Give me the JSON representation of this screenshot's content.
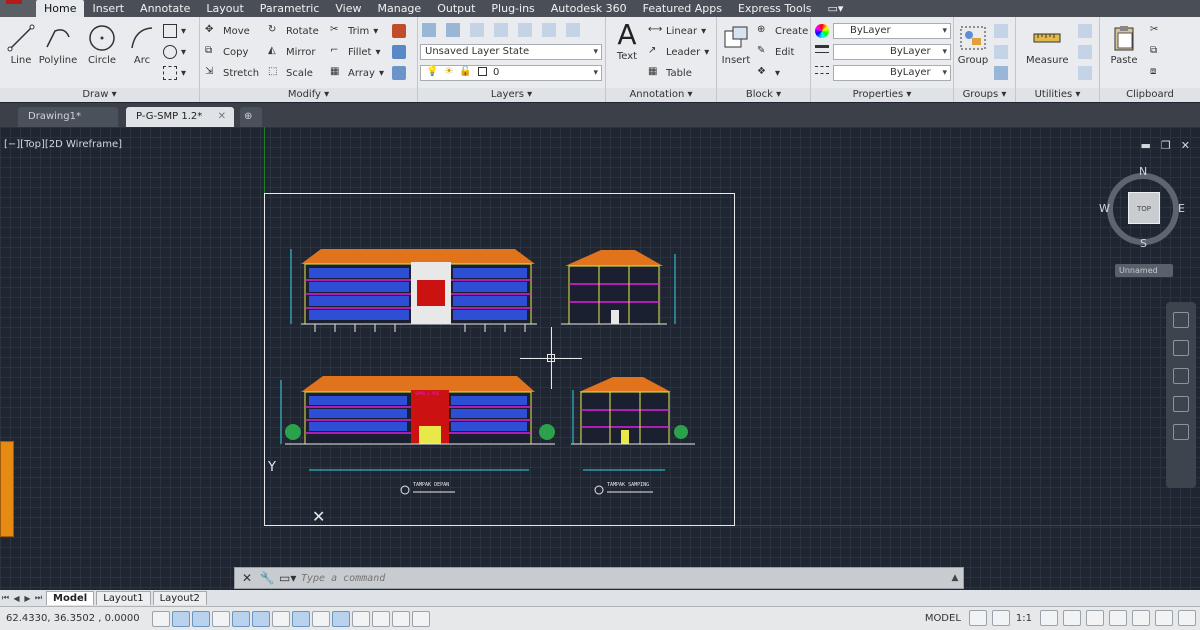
{
  "menu": [
    "Home",
    "Insert",
    "Annotate",
    "Layout",
    "Parametric",
    "View",
    "Manage",
    "Output",
    "Plug-ins",
    "Autodesk 360",
    "Featured Apps",
    "Express Tools"
  ],
  "ribbon": {
    "draw": {
      "title": "Draw",
      "line": "Line",
      "polyline": "Polyline",
      "circle": "Circle",
      "arc": "Arc"
    },
    "modify": {
      "title": "Modify",
      "move": "Move",
      "rotate": "Rotate",
      "trim": "Trim",
      "copy": "Copy",
      "mirror": "Mirror",
      "fillet": "Fillet",
      "stretch": "Stretch",
      "scale": "Scale",
      "array": "Array"
    },
    "layers": {
      "title": "Layers",
      "layer_state": "Unsaved Layer State",
      "current_layer": "0"
    },
    "annotation": {
      "title": "Annotation",
      "text": "Text",
      "linear": "Linear",
      "leader": "Leader",
      "table": "Table"
    },
    "block": {
      "title": "Block",
      "insert": "Insert",
      "create": "Create",
      "edit": "Edit"
    },
    "properties": {
      "title": "Properties",
      "color": "ByLayer",
      "linetype": "ByLayer",
      "lineweight": "ByLayer"
    },
    "groups": {
      "title": "Groups",
      "group": "Group"
    },
    "utilities": {
      "title": "Utilities",
      "measure": "Measure"
    },
    "clipboard": {
      "title": "Clipboard",
      "paste": "Paste"
    }
  },
  "file_tabs": [
    {
      "label": "Drawing1*"
    },
    {
      "label": "P-G-SMP 1.2*"
    }
  ],
  "viewport": {
    "label": "[−][Top][2D Wireframe]",
    "view_cube_top": "TOP",
    "compass": {
      "n": "N",
      "s": "S",
      "w": "W",
      "e": "E"
    },
    "ucs_name": "Unnamed"
  },
  "drawing": {
    "caption_front": "TAMPAK DEPAN",
    "caption_side": "TAMPAK SAMPING",
    "sign_text": "SMPN 1 YOG"
  },
  "command": {
    "placeholder": "Type a command"
  },
  "layout_tabs": [
    "Model",
    "Layout1",
    "Layout2"
  ],
  "status": {
    "coords": "62.4330, 36.3502 , 0.0000",
    "model": "MODEL",
    "scale": "1:1"
  },
  "colors": {
    "roof": "#e0731b",
    "window_blue": "#2c4fd6",
    "slab_magenta": "#e01ee0",
    "structure_yellow": "#e8e84a",
    "accent_red": "#cc1111",
    "dim_cyan": "#33d6e6"
  }
}
